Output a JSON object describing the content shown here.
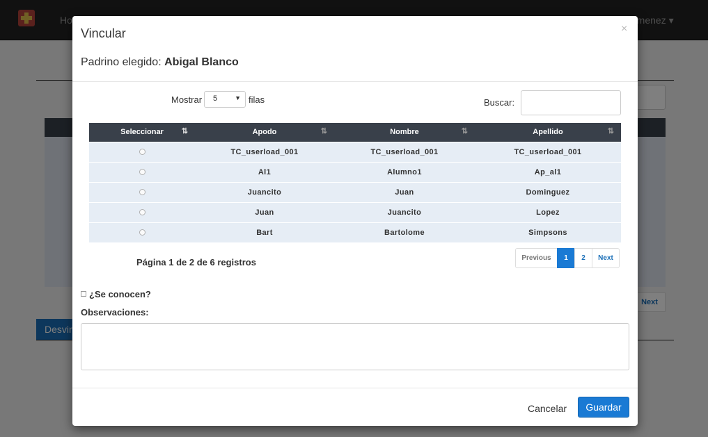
{
  "background": {
    "nav_home": "Ho",
    "nav_user": "ggimenez ▾",
    "next_label": "Next",
    "desvincular_label": "Desvin"
  },
  "modal": {
    "title": "Vincular",
    "close_icon": "×",
    "padrino_label": "Padrino elegido:",
    "padrino_name": "Abigal Blanco",
    "length": {
      "prefix": "Mostrar",
      "value": "5",
      "suffix": "filas"
    },
    "search": {
      "label": "Buscar:",
      "value": ""
    },
    "table": {
      "columns": [
        "Seleccionar",
        "Apodo",
        "Nombre",
        "Apellido"
      ],
      "rows": [
        [
          "TC_userload_001",
          "TC_userload_001",
          "TC_userload_001"
        ],
        [
          "Al1",
          "Alumno1",
          "Ap_al1"
        ],
        [
          "Juancito",
          "Juan",
          "Dominguez"
        ],
        [
          "Juan",
          "Juancito",
          "Lopez"
        ],
        [
          "Bart",
          "Bartolome",
          "Simpsons"
        ]
      ]
    },
    "info": "Página 1 de 2 de 6 registros",
    "pager": {
      "previous": "Previous",
      "pages": [
        "1",
        "2"
      ],
      "current": "1",
      "next": "Next"
    },
    "conocen_label": "¿Se conocen?",
    "observaciones_label": "Observaciones:",
    "observaciones_value": "",
    "cancel_label": "Cancelar",
    "save_label": "Guardar"
  },
  "colors": {
    "accent": "#1a7ad4",
    "table_header": "#39404a",
    "table_row": "#e6edf5",
    "navbar": "#222222"
  },
  "icons": [
    "app-logo-icon",
    "close-icon",
    "sort-icon",
    "dropdown-arrow-icon"
  ]
}
